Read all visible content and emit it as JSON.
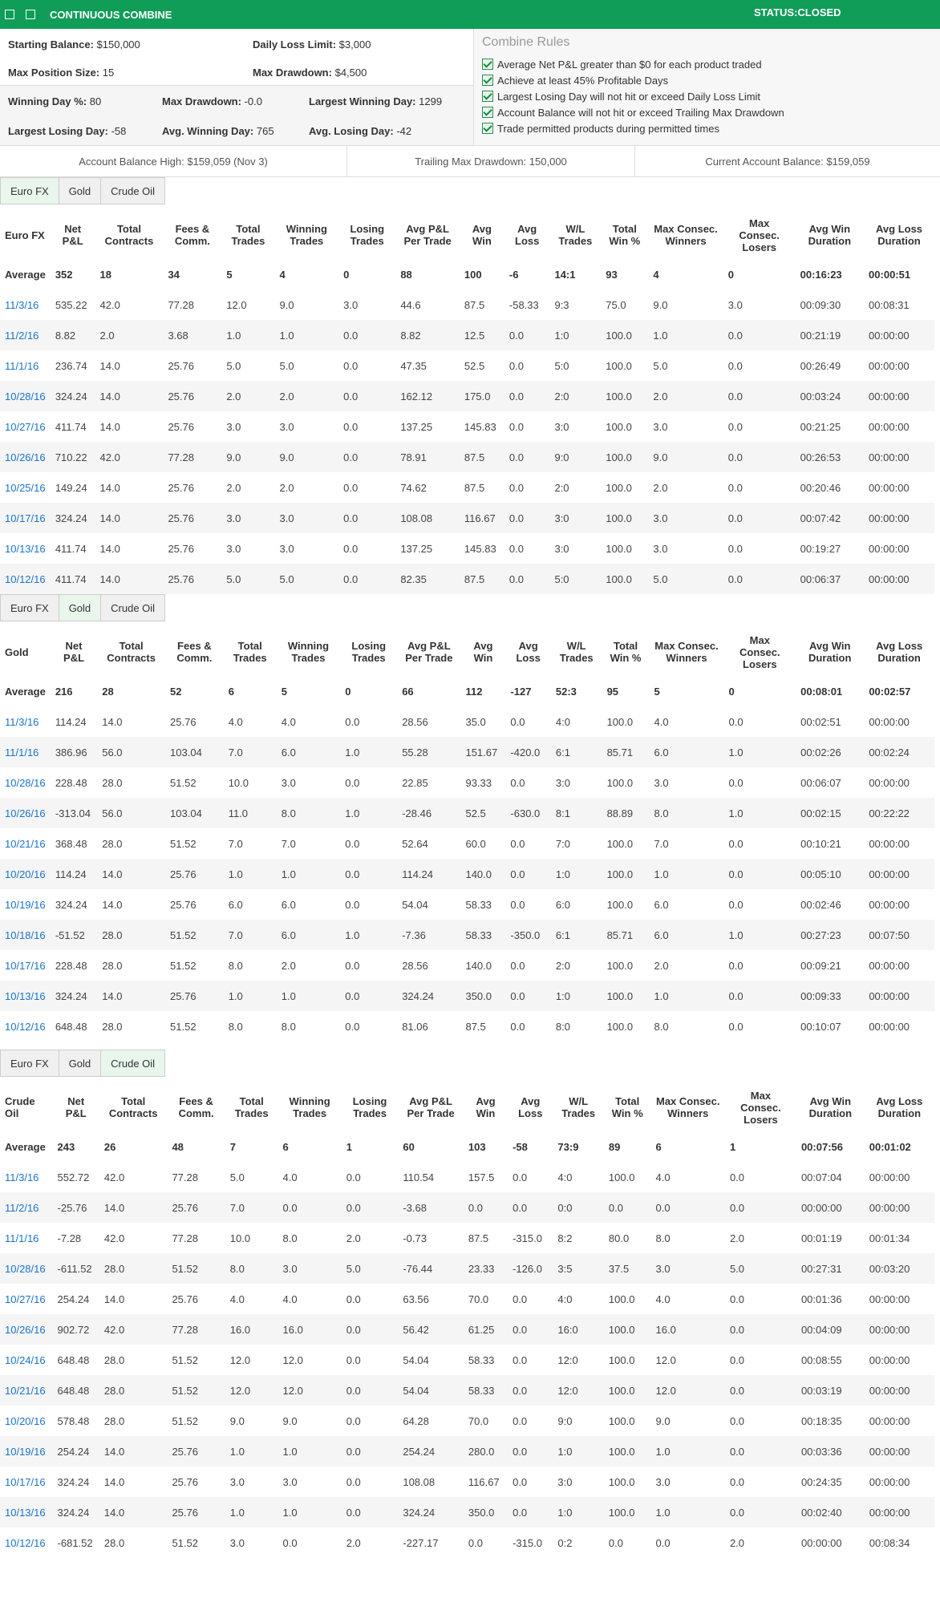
{
  "header": {
    "title": "CONTINUOUS COMBINE",
    "status": "STATUS:CLOSED"
  },
  "summary": {
    "starting_balance_label": "Starting Balance:",
    "starting_balance": "$150,000",
    "daily_loss_limit_label": "Daily Loss Limit:",
    "daily_loss_limit": "$3,000",
    "max_position_label": "Max Position Size:",
    "max_position": "15",
    "max_drawdown_label": "Max Drawdown:",
    "max_drawdown": "$4,500",
    "winning_day_label": "Winning Day %:",
    "winning_day": "80",
    "max_dd2_label": "Max Drawdown:",
    "max_dd2": "-0.0",
    "largest_win_label": "Largest Winning Day:",
    "largest_win": "1299",
    "largest_loss_label": "Largest Losing Day:",
    "largest_loss": "-58",
    "avg_win_label": "Avg. Winning Day:",
    "avg_win": "765",
    "avg_loss_label": "Avg. Losing Day:",
    "avg_loss": "-42"
  },
  "rules": {
    "title": "Combine Rules",
    "items": [
      "Average Net P&L greater than $0 for each product traded",
      "Achieve at least 45% Profitable Days",
      "Largest Losing Day will not hit or exceed Daily Loss Limit",
      "Account Balance will not hit or exceed Trailing Max Drawdown",
      "Trade permitted products during permitted times"
    ]
  },
  "balances": {
    "high": "Account Balance High: $159,059 (Nov 3)",
    "trailing": "Trailing Max Drawdown: 150,000",
    "current": "Current Account Balance: $159,059"
  },
  "tab_labels": [
    "Euro FX",
    "Gold",
    "Crude Oil"
  ],
  "columns": [
    "Net P&L",
    "Total Contracts",
    "Fees & Comm.",
    "Total Trades",
    "Winning Trades",
    "Losing Trades",
    "Avg P&L Per Trade",
    "Avg Win",
    "Avg Loss",
    "W/L Trades",
    "Total Win %",
    "Max Consec. Winners",
    "Max Consec. Losers",
    "Avg Win Duration",
    "Avg Loss Duration"
  ],
  "sections": [
    {
      "name": "Euro FX",
      "active_tab": 0,
      "average": [
        "Average",
        "352",
        "18",
        "34",
        "5",
        "4",
        "0",
        "88",
        "100",
        "-6",
        "14:1",
        "93",
        "4",
        "0",
        "00:16:23",
        "00:00:51"
      ],
      "rows": [
        [
          "11/3/16",
          "535.22",
          "42.0",
          "77.28",
          "12.0",
          "9.0",
          "3.0",
          "44.6",
          "87.5",
          "-58.33",
          "9:3",
          "75.0",
          "9.0",
          "3.0",
          "00:09:30",
          "00:08:31"
        ],
        [
          "11/2/16",
          "8.82",
          "2.0",
          "3.68",
          "1.0",
          "1.0",
          "0.0",
          "8.82",
          "12.5",
          "0.0",
          "1:0",
          "100.0",
          "1.0",
          "0.0",
          "00:21:19",
          "00:00:00"
        ],
        [
          "11/1/16",
          "236.74",
          "14.0",
          "25.76",
          "5.0",
          "5.0",
          "0.0",
          "47.35",
          "52.5",
          "0.0",
          "5:0",
          "100.0",
          "5.0",
          "0.0",
          "00:26:49",
          "00:00:00"
        ],
        [
          "10/28/16",
          "324.24",
          "14.0",
          "25.76",
          "2.0",
          "2.0",
          "0.0",
          "162.12",
          "175.0",
          "0.0",
          "2:0",
          "100.0",
          "2.0",
          "0.0",
          "00:03:24",
          "00:00:00"
        ],
        [
          "10/27/16",
          "411.74",
          "14.0",
          "25.76",
          "3.0",
          "3.0",
          "0.0",
          "137.25",
          "145.83",
          "0.0",
          "3:0",
          "100.0",
          "3.0",
          "0.0",
          "00:21:25",
          "00:00:00"
        ],
        [
          "10/26/16",
          "710.22",
          "42.0",
          "77.28",
          "9.0",
          "9.0",
          "0.0",
          "78.91",
          "87.5",
          "0.0",
          "9:0",
          "100.0",
          "9.0",
          "0.0",
          "00:26:53",
          "00:00:00"
        ],
        [
          "10/25/16",
          "149.24",
          "14.0",
          "25.76",
          "2.0",
          "2.0",
          "0.0",
          "74.62",
          "87.5",
          "0.0",
          "2:0",
          "100.0",
          "2.0",
          "0.0",
          "00:20:46",
          "00:00:00"
        ],
        [
          "10/17/16",
          "324.24",
          "14.0",
          "25.76",
          "3.0",
          "3.0",
          "0.0",
          "108.08",
          "116.67",
          "0.0",
          "3:0",
          "100.0",
          "3.0",
          "0.0",
          "00:07:42",
          "00:00:00"
        ],
        [
          "10/13/16",
          "411.74",
          "14.0",
          "25.76",
          "3.0",
          "3.0",
          "0.0",
          "137.25",
          "145.83",
          "0.0",
          "3:0",
          "100.0",
          "3.0",
          "0.0",
          "00:19:27",
          "00:00:00"
        ],
        [
          "10/12/16",
          "411.74",
          "14.0",
          "25.76",
          "5.0",
          "5.0",
          "0.0",
          "82.35",
          "87.5",
          "0.0",
          "5:0",
          "100.0",
          "5.0",
          "0.0",
          "00:06:37",
          "00:00:00"
        ]
      ]
    },
    {
      "name": "Gold",
      "active_tab": 1,
      "average": [
        "Average",
        "216",
        "28",
        "52",
        "6",
        "5",
        "0",
        "66",
        "112",
        "-127",
        "52:3",
        "95",
        "5",
        "0",
        "00:08:01",
        "00:02:57"
      ],
      "rows": [
        [
          "11/3/16",
          "114.24",
          "14.0",
          "25.76",
          "4.0",
          "4.0",
          "0.0",
          "28.56",
          "35.0",
          "0.0",
          "4:0",
          "100.0",
          "4.0",
          "0.0",
          "00:02:51",
          "00:00:00"
        ],
        [
          "11/1/16",
          "386.96",
          "56.0",
          "103.04",
          "7.0",
          "6.0",
          "1.0",
          "55.28",
          "151.67",
          "-420.0",
          "6:1",
          "85.71",
          "6.0",
          "1.0",
          "00:02:26",
          "00:02:24"
        ],
        [
          "10/28/16",
          "228.48",
          "28.0",
          "51.52",
          "10.0",
          "3.0",
          "0.0",
          "22.85",
          "93.33",
          "0.0",
          "3:0",
          "100.0",
          "3.0",
          "0.0",
          "00:06:07",
          "00:00:00"
        ],
        [
          "10/26/16",
          "-313.04",
          "56.0",
          "103.04",
          "11.0",
          "8.0",
          "1.0",
          "-28.46",
          "52.5",
          "-630.0",
          "8:1",
          "88.89",
          "8.0",
          "1.0",
          "00:02:15",
          "00:22:22"
        ],
        [
          "10/21/16",
          "368.48",
          "28.0",
          "51.52",
          "7.0",
          "7.0",
          "0.0",
          "52.64",
          "60.0",
          "0.0",
          "7:0",
          "100.0",
          "7.0",
          "0.0",
          "00:10:21",
          "00:00:00"
        ],
        [
          "10/20/16",
          "114.24",
          "14.0",
          "25.76",
          "1.0",
          "1.0",
          "0.0",
          "114.24",
          "140.0",
          "0.0",
          "1:0",
          "100.0",
          "1.0",
          "0.0",
          "00:05:10",
          "00:00:00"
        ],
        [
          "10/19/16",
          "324.24",
          "14.0",
          "25.76",
          "6.0",
          "6.0",
          "0.0",
          "54.04",
          "58.33",
          "0.0",
          "6:0",
          "100.0",
          "6.0",
          "0.0",
          "00:02:46",
          "00:00:00"
        ],
        [
          "10/18/16",
          "-51.52",
          "28.0",
          "51.52",
          "7.0",
          "6.0",
          "1.0",
          "-7.36",
          "58.33",
          "-350.0",
          "6:1",
          "85.71",
          "6.0",
          "1.0",
          "00:27:23",
          "00:07:50"
        ],
        [
          "10/17/16",
          "228.48",
          "28.0",
          "51.52",
          "8.0",
          "2.0",
          "0.0",
          "28.56",
          "140.0",
          "0.0",
          "2:0",
          "100.0",
          "2.0",
          "0.0",
          "00:09:21",
          "00:00:00"
        ],
        [
          "10/13/16",
          "324.24",
          "14.0",
          "25.76",
          "1.0",
          "1.0",
          "0.0",
          "324.24",
          "350.0",
          "0.0",
          "1:0",
          "100.0",
          "1.0",
          "0.0",
          "00:09:33",
          "00:00:00"
        ],
        [
          "10/12/16",
          "648.48",
          "28.0",
          "51.52",
          "8.0",
          "8.0",
          "0.0",
          "81.06",
          "87.5",
          "0.0",
          "8:0",
          "100.0",
          "8.0",
          "0.0",
          "00:10:07",
          "00:00:00"
        ]
      ]
    },
    {
      "name": "Crude Oil",
      "active_tab": 2,
      "average": [
        "Average",
        "243",
        "26",
        "48",
        "7",
        "6",
        "1",
        "60",
        "103",
        "-58",
        "73:9",
        "89",
        "6",
        "1",
        "00:07:56",
        "00:01:02"
      ],
      "rows": [
        [
          "11/3/16",
          "552.72",
          "42.0",
          "77.28",
          "5.0",
          "4.0",
          "0.0",
          "110.54",
          "157.5",
          "0.0",
          "4:0",
          "100.0",
          "4.0",
          "0.0",
          "00:07:04",
          "00:00:00"
        ],
        [
          "11/2/16",
          "-25.76",
          "14.0",
          "25.76",
          "7.0",
          "0.0",
          "0.0",
          "-3.68",
          "0.0",
          "0.0",
          "0:0",
          "0.0",
          "0.0",
          "0.0",
          "00:00:00",
          "00:00:00"
        ],
        [
          "11/1/16",
          "-7.28",
          "42.0",
          "77.28",
          "10.0",
          "8.0",
          "2.0",
          "-0.73",
          "87.5",
          "-315.0",
          "8:2",
          "80.0",
          "8.0",
          "2.0",
          "00:01:19",
          "00:01:34"
        ],
        [
          "10/28/16",
          "-611.52",
          "28.0",
          "51.52",
          "8.0",
          "3.0",
          "5.0",
          "-76.44",
          "23.33",
          "-126.0",
          "3:5",
          "37.5",
          "3.0",
          "5.0",
          "00:27:31",
          "00:03:20"
        ],
        [
          "10/27/16",
          "254.24",
          "14.0",
          "25.76",
          "4.0",
          "4.0",
          "0.0",
          "63.56",
          "70.0",
          "0.0",
          "4:0",
          "100.0",
          "4.0",
          "0.0",
          "00:01:36",
          "00:00:00"
        ],
        [
          "10/26/16",
          "902.72",
          "42.0",
          "77.28",
          "16.0",
          "16.0",
          "0.0",
          "56.42",
          "61.25",
          "0.0",
          "16:0",
          "100.0",
          "16.0",
          "0.0",
          "00:04:09",
          "00:00:00"
        ],
        [
          "10/24/16",
          "648.48",
          "28.0",
          "51.52",
          "12.0",
          "12.0",
          "0.0",
          "54.04",
          "58.33",
          "0.0",
          "12:0",
          "100.0",
          "12.0",
          "0.0",
          "00:08:55",
          "00:00:00"
        ],
        [
          "10/21/16",
          "648.48",
          "28.0",
          "51.52",
          "12.0",
          "12.0",
          "0.0",
          "54.04",
          "58.33",
          "0.0",
          "12:0",
          "100.0",
          "12.0",
          "0.0",
          "00:03:19",
          "00:00:00"
        ],
        [
          "10/20/16",
          "578.48",
          "28.0",
          "51.52",
          "9.0",
          "9.0",
          "0.0",
          "64.28",
          "70.0",
          "0.0",
          "9:0",
          "100.0",
          "9.0",
          "0.0",
          "00:18:35",
          "00:00:00"
        ],
        [
          "10/19/16",
          "254.24",
          "14.0",
          "25.76",
          "1.0",
          "1.0",
          "0.0",
          "254.24",
          "280.0",
          "0.0",
          "1:0",
          "100.0",
          "1.0",
          "0.0",
          "00:03:36",
          "00:00:00"
        ],
        [
          "10/17/16",
          "324.24",
          "14.0",
          "25.76",
          "3.0",
          "3.0",
          "0.0",
          "108.08",
          "116.67",
          "0.0",
          "3:0",
          "100.0",
          "3.0",
          "0.0",
          "00:24:35",
          "00:00:00"
        ],
        [
          "10/13/16",
          "324.24",
          "14.0",
          "25.76",
          "1.0",
          "1.0",
          "0.0",
          "324.24",
          "350.0",
          "0.0",
          "1:0",
          "100.0",
          "1.0",
          "0.0",
          "00:02:40",
          "00:00:00"
        ],
        [
          "10/12/16",
          "-681.52",
          "28.0",
          "51.52",
          "3.0",
          "0.0",
          "2.0",
          "-227.17",
          "0.0",
          "-315.0",
          "0:2",
          "0.0",
          "0.0",
          "2.0",
          "00:00:00",
          "00:08:34"
        ]
      ]
    }
  ]
}
